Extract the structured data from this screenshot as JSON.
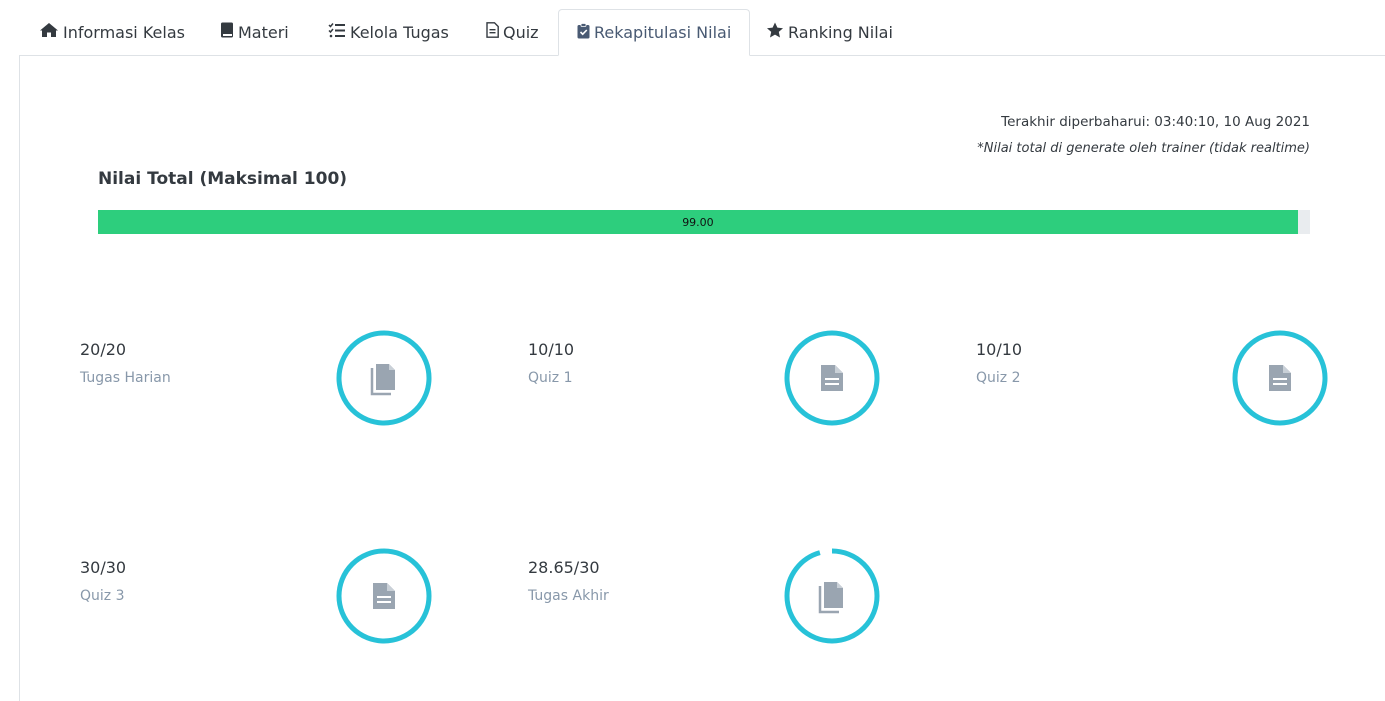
{
  "tabs": [
    {
      "label": "Informasi Kelas",
      "icon": "home-icon"
    },
    {
      "label": "Materi",
      "icon": "book-icon"
    },
    {
      "label": "Kelola Tugas",
      "icon": "task-list-icon"
    },
    {
      "label": "Quiz",
      "icon": "document-icon"
    },
    {
      "label": "Rekapitulasi Nilai",
      "icon": "clipboard-check-icon",
      "active": true
    },
    {
      "label": "Ranking Nilai",
      "icon": "star-icon"
    }
  ],
  "updated_text": "Terakhir diperbaharui: 03:40:10, 10 Aug 2021",
  "note_text": "*Nilai total di generate oleh trainer (tidak realtime)",
  "total": {
    "title": "Nilai Total (Maksimal 100)",
    "value": 99.0,
    "value_label": "99.00",
    "max": 100
  },
  "cards": [
    {
      "score": "20/20",
      "label": "Tugas Harian",
      "fraction": 1.0,
      "icon": "copy-document-icon"
    },
    {
      "score": "10/10",
      "label": "Quiz 1",
      "fraction": 1.0,
      "icon": "document-icon"
    },
    {
      "score": "10/10",
      "label": "Quiz 2",
      "fraction": 1.0,
      "icon": "document-icon"
    },
    {
      "score": "30/30",
      "label": "Quiz 3",
      "fraction": 1.0,
      "icon": "document-icon"
    },
    {
      "score": "28.65/30",
      "label": "Tugas Akhir",
      "fraction": 0.955,
      "icon": "copy-document-icon"
    }
  ],
  "colors": {
    "progress": "#2dce7d",
    "ring": "#27c2d8",
    "icon": "#9aa5b1",
    "active_tab_text": "#495a73"
  }
}
